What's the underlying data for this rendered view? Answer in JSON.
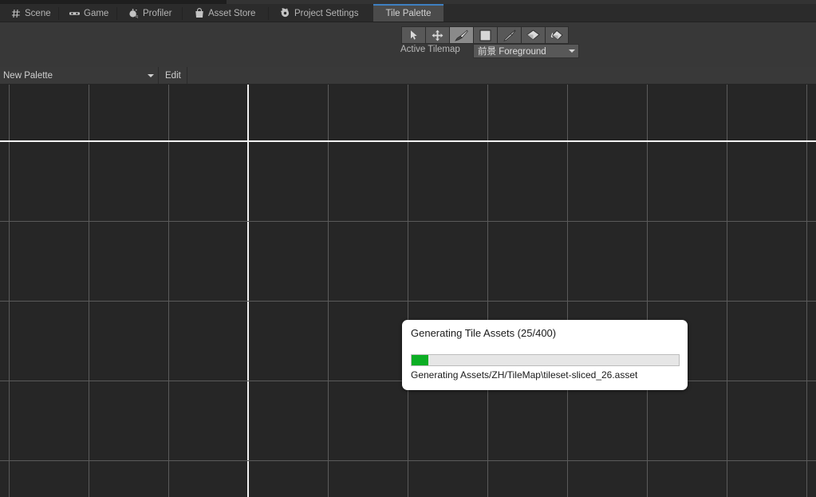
{
  "window": {
    "title": "Tile Palette",
    "background_color": "#383838",
    "accent_color": "#3e7fc1"
  },
  "tabbar": {
    "tabs": [
      {
        "label": "Scene",
        "icon": "grid-icon",
        "active": false
      },
      {
        "label": "Game",
        "icon": "gamepad-icon",
        "active": false
      },
      {
        "label": "Profiler",
        "icon": "stopwatch-icon",
        "active": false
      },
      {
        "label": "Asset Store",
        "icon": "shopping-bag-icon",
        "active": false
      },
      {
        "label": "Project Settings",
        "icon": "gear-icon",
        "active": false
      },
      {
        "label": "Tile Palette",
        "icon": "none",
        "active": true
      }
    ]
  },
  "toolbar": {
    "tools": [
      {
        "name": "select-tool",
        "icon": "cursor-arrow-icon",
        "active": false
      },
      {
        "name": "move-tool",
        "icon": "move-arrows-icon",
        "active": false
      },
      {
        "name": "paint-tool",
        "icon": "paintbrush-icon",
        "active": true
      },
      {
        "name": "box-fill-tool",
        "icon": "filled-square-icon",
        "active": false
      },
      {
        "name": "picker-tool",
        "icon": "eyedropper-icon",
        "active": false
      },
      {
        "name": "erase-tool",
        "icon": "eraser-icon",
        "active": false
      },
      {
        "name": "fill-tool",
        "icon": "paint-bucket-icon",
        "active": false
      }
    ],
    "active_tilemap_label": "Active Tilemap",
    "active_tilemap_value": "前景 Foreground"
  },
  "palettebar": {
    "palette_value": "New Palette",
    "edit_label": "Edit"
  },
  "canvas": {
    "grid_color": "#5a5a5a",
    "highlight_color": "#f2f2f2",
    "background_color": "#262626",
    "cell_size": 100,
    "vertical_lines": [
      11,
      111,
      211,
      311,
      411,
      511,
      611,
      711,
      811,
      911,
      1011
    ],
    "horizontal_lines": [
      71,
      171,
      271,
      371,
      471
    ],
    "highlight_vertical": 311,
    "highlight_horizontal": 71
  },
  "dialog": {
    "title": "Generating Tile Assets (25/400)",
    "status": "Generating Assets/ZH/TileMap\\tileset-sliced_26.asset",
    "progress_current": 25,
    "progress_total": 400,
    "progress_percent": 6.25,
    "fill_color": "#0cae24",
    "track_color": "#e6e6e6"
  }
}
